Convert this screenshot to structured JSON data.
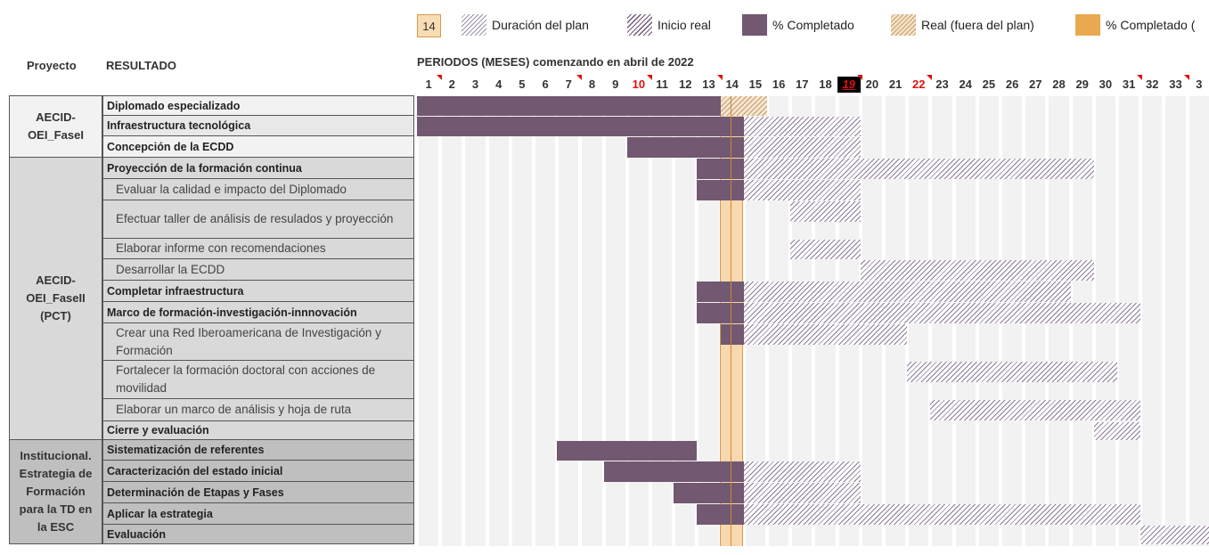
{
  "legend": {
    "highlight_value": "14",
    "items": [
      "Duración del plan",
      "Inicio real",
      "% Completado",
      "Real (fuera del plan)",
      "% Completado ("
    ]
  },
  "headers": {
    "proyecto": "Proyecto",
    "resultado": "RESULTADO",
    "periods_title": "PERIODOS (MESES) comenzando en abril de 2022"
  },
  "periods": [
    "1",
    "2",
    "3",
    "4",
    "5",
    "6",
    "7",
    "8",
    "9",
    "10",
    "11",
    "12",
    "13",
    "14",
    "15",
    "16",
    "17",
    "18",
    "19",
    "20",
    "21",
    "22",
    "23",
    "24",
    "25",
    "26",
    "27",
    "28",
    "29",
    "30",
    "31",
    "32",
    "33",
    "3"
  ],
  "current_period": "14",
  "projects": [
    {
      "name": "AECID-\nOEI_FaseI"
    },
    {
      "name": "AECID-\nOEI_FaseII\n(PCT)"
    },
    {
      "name": "Institucional.\nEstrategia de\nFormación\npara la TD en\nla ESC"
    }
  ],
  "rows": [
    {
      "label": "Diplomado especializado"
    },
    {
      "label": "Infraestructura tecnológica"
    },
    {
      "label": "Concepción de la ECDD"
    },
    {
      "label": "Proyección de la formación continua"
    },
    {
      "label": "Evaluar la calidad e impacto del Diplomado"
    },
    {
      "label": "Efectuar taller de análisis de resulados y proyección"
    },
    {
      "label": "Elaborar informe con recomendaciones"
    },
    {
      "label": "Desarrollar la ECDD"
    },
    {
      "label": "Completar infraestructura"
    },
    {
      "label": "Marco de formación-investigación-innnovación"
    },
    {
      "label": "Crear una Red Iberoamericana de Investigación y Formación"
    },
    {
      "label": "Fortalecer la formación doctoral con acciones de movilidad"
    },
    {
      "label": "Elaborar un marco de análisis y hoja de ruta"
    },
    {
      "label": "Cierre y evaluación"
    },
    {
      "label": "Sistematización de referentes"
    },
    {
      "label": "Caracterización del estado inicial"
    },
    {
      "label": "Determinación de Etapas y Fases"
    },
    {
      "label": "Aplicar la estrategia"
    },
    {
      "label": "Evaluación"
    }
  ],
  "tasks": [
    {
      "plan_start": 1,
      "plan_months": 13,
      "pct_start": 1,
      "pct_months": 13,
      "real_start": 13,
      "real_months": 3
    },
    {
      "plan_start": 15,
      "plan_months": 5,
      "pct_start": 1,
      "pct_months": 14
    },
    {
      "plan_start": 15,
      "plan_months": 5,
      "pct_start": 10,
      "pct_months": 5
    },
    {
      "plan_start": 15,
      "plan_months": 15,
      "pct_start": 13,
      "pct_months": 2
    },
    {
      "plan_start": 15,
      "plan_months": 5,
      "pct_start": 13,
      "pct_months": 2
    },
    {
      "plan_start": 17,
      "plan_months": 3
    },
    {
      "plan_start": 17,
      "plan_months": 3
    },
    {
      "plan_start": 20,
      "plan_months": 10
    },
    {
      "plan_start": 15,
      "plan_months": 14,
      "pct_start": 13,
      "pct_months": 2
    },
    {
      "plan_start": 15,
      "plan_months": 17,
      "pct_start": 13,
      "pct_months": 2
    },
    {
      "plan_start": 15,
      "plan_months": 7,
      "pct_start": 14,
      "pct_months": 1
    },
    {
      "plan_start": 22,
      "plan_months": 9
    },
    {
      "plan_start": 23,
      "plan_months": 9
    },
    {
      "plan_start": 30,
      "plan_months": 2
    },
    {
      "pct_start": 7,
      "pct_months": 6
    },
    {
      "plan_start": 15,
      "plan_months": 5,
      "pct_start": 9,
      "pct_months": 6
    },
    {
      "plan_start": 15,
      "plan_months": 5,
      "pct_start": 12,
      "pct_months": 3
    },
    {
      "plan_start": 15,
      "plan_months": 17,
      "pct_start": 13,
      "pct_months": 2
    },
    {
      "plan_start": 32,
      "plan_months": 3
    }
  ],
  "colors": {
    "percent_complete": "#725871",
    "current_period": "#f8d8ae",
    "legend_orange": "#e8a94f",
    "flag_red": "#e01010"
  }
}
